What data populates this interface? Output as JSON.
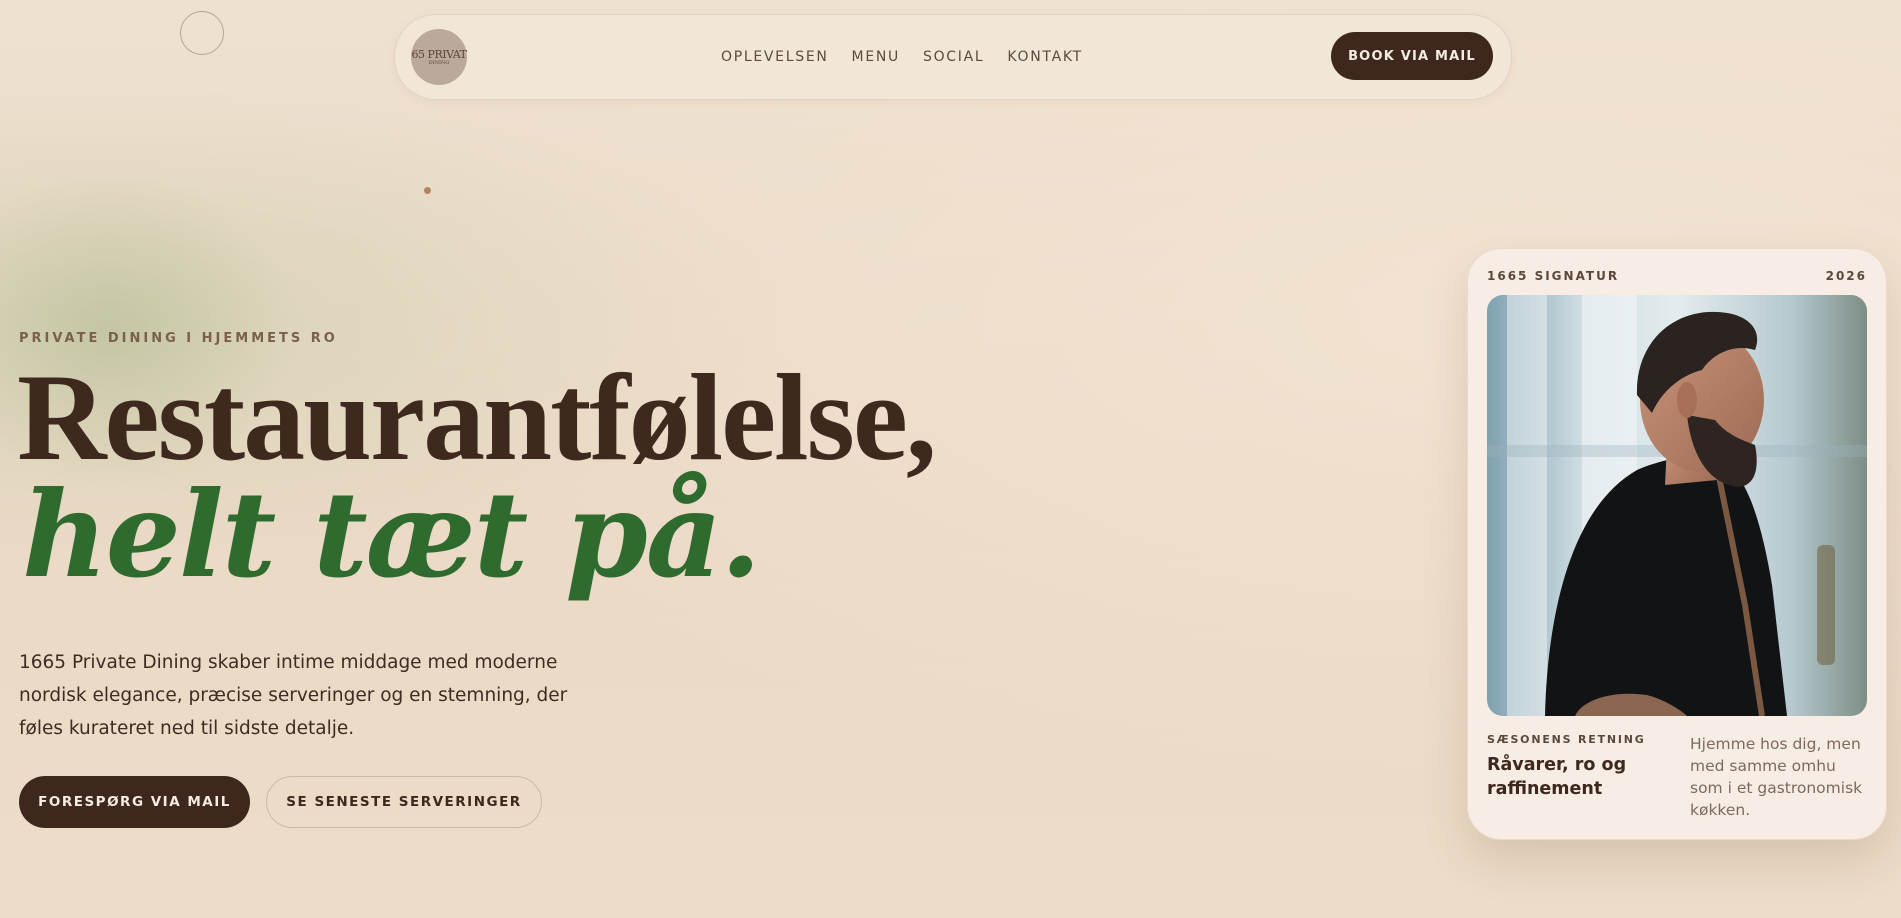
{
  "nav": {
    "logo_mark": "65 PRIVAT",
    "logo_sub": "DINING",
    "links": [
      "OPLEVELSEN",
      "MENU",
      "SOCIAL",
      "KONTAKT"
    ],
    "cta": "BOOK VIA MAIL"
  },
  "hero": {
    "eyebrow": "PRIVATE DINING I HJEMMETS RO",
    "headline_line1": "Restaurantfølelse,",
    "headline_line2": "helt tæt på.",
    "lead": "1665 Private Dining skaber intime middage med moderne nordisk elegance, præcise serveringer og en stemning, der føles kurateret ned til sidste detalje.",
    "primary_button": "FORESPØRG VIA MAIL",
    "secondary_button": "SE SENESTE SERVERINGER"
  },
  "card": {
    "label": "1665 SIGNATUR",
    "year": "2026",
    "foot_eyebrow": "SÆSONENS RETNING",
    "foot_title": "Råvarer, ro og raffinement",
    "foot_text": "Hjemme hos dig, men med samme omhu som i et gastronomisk køkken."
  },
  "colors": {
    "dark_brown": "#3e281d",
    "green_accent": "#2f6b2e",
    "background": "#ecdcc8",
    "dot_accent": "#b5835b"
  }
}
